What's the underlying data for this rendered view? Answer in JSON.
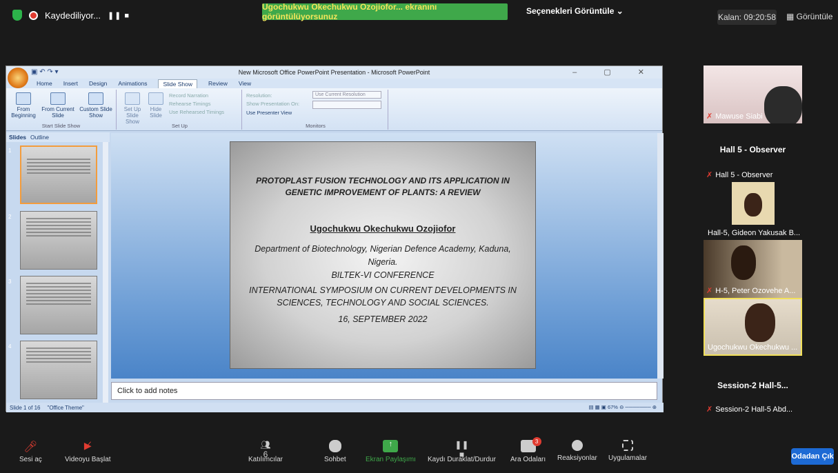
{
  "top": {
    "recording": "Kaydediliyor...",
    "rec_controls": "❚❚  ■",
    "share_banner": "Ugochukwu Okechukwu Ozojiofor... ekranını görüntülüyorsunuz",
    "view_options": "Seçenekleri Görüntüle ⌄",
    "remaining": "Kalan: 09:20:58",
    "view_button": "Görüntüle"
  },
  "ppt": {
    "window_title": "New Microsoft Office PowerPoint Presentation - Microsoft PowerPoint",
    "tabs": [
      "Home",
      "Insert",
      "Design",
      "Animations",
      "Slide Show",
      "Review",
      "View"
    ],
    "ribbon": {
      "from_beginning": "From Beginning",
      "from_current": "From Current Slide",
      "custom_show": "Custom Slide Show",
      "group_start": "Start Slide Show",
      "setup_show": "Set Up Slide Show",
      "hide_slide": "Hide Slide",
      "record_narration": "Record Narration",
      "rehearse": "Rehearse Timings",
      "use_rehearsed": "Use Rehearsed Timings",
      "group_setup": "Set Up",
      "resolution": "Resolution:",
      "resolution_value": "Use Current Resolution",
      "show_on": "Show Presentation On:",
      "presenter_view": "Use Presenter View",
      "group_monitors": "Monitors"
    },
    "panel_tabs": [
      "Slides",
      "Outline"
    ],
    "thumbnails": [
      "1",
      "2",
      "3",
      "4"
    ],
    "slide": {
      "title": "PROTOPLAST FUSION TECHNOLOGY AND ITS APPLICATION IN GENETIC IMPROVEMENT OF PLANTS: A REVIEW",
      "author": "Ugochukwu Okechukwu Ozojiofor",
      "department": "Department of Biotechnology, Nigerian Defence Academy, Kaduna, Nigeria.",
      "conference": "BILTEK-VI CONFERENCE",
      "symposium": "INTERNATIONAL SYMPOSIUM ON CURRENT DEVELOPMENTS IN SCIENCES, TECHNOLOGY AND SOCIAL SCIENCES.",
      "date": "16, SEPTEMBER 2022"
    },
    "notes_placeholder": "Click to add notes",
    "status_slide": "Slide 1 of 16",
    "status_theme": "\"Office Theme\"",
    "zoom": "67%"
  },
  "gallery": [
    {
      "name": "Mawuse Siabi",
      "type": "video"
    },
    {
      "name": "Hall 5 - Observer",
      "type": "name"
    },
    {
      "name": "Hall-5, Gideon Yakusak B...",
      "type": "video"
    },
    {
      "name": "H-5, Peter Ozovehe A...",
      "type": "video"
    },
    {
      "name": "Ugochukwu Okechukwu ...",
      "type": "video"
    },
    {
      "name": "Session-2 Hall-5...",
      "sub": "Session-2 Hall-5 Abd...",
      "type": "name"
    }
  ],
  "toolbar": {
    "audio": "Sesi aç",
    "video": "Videoyu Başlat",
    "participants": "Katılımcılar",
    "participants_count": "6",
    "chat": "Sohbet",
    "share": "Ekran Paylaşımı",
    "pause_rec": "Kaydı Duraklat/Durdur",
    "breakout": "Ara Odaları",
    "breakout_badge": "3",
    "reactions": "Reaksiyonlar",
    "apps": "Uygulamalar",
    "leave": "Odadan Çık"
  },
  "colors": {
    "share_green": "#3fa84a",
    "leave_blue": "#1d6ad4",
    "rec_red": "#e03c31"
  }
}
